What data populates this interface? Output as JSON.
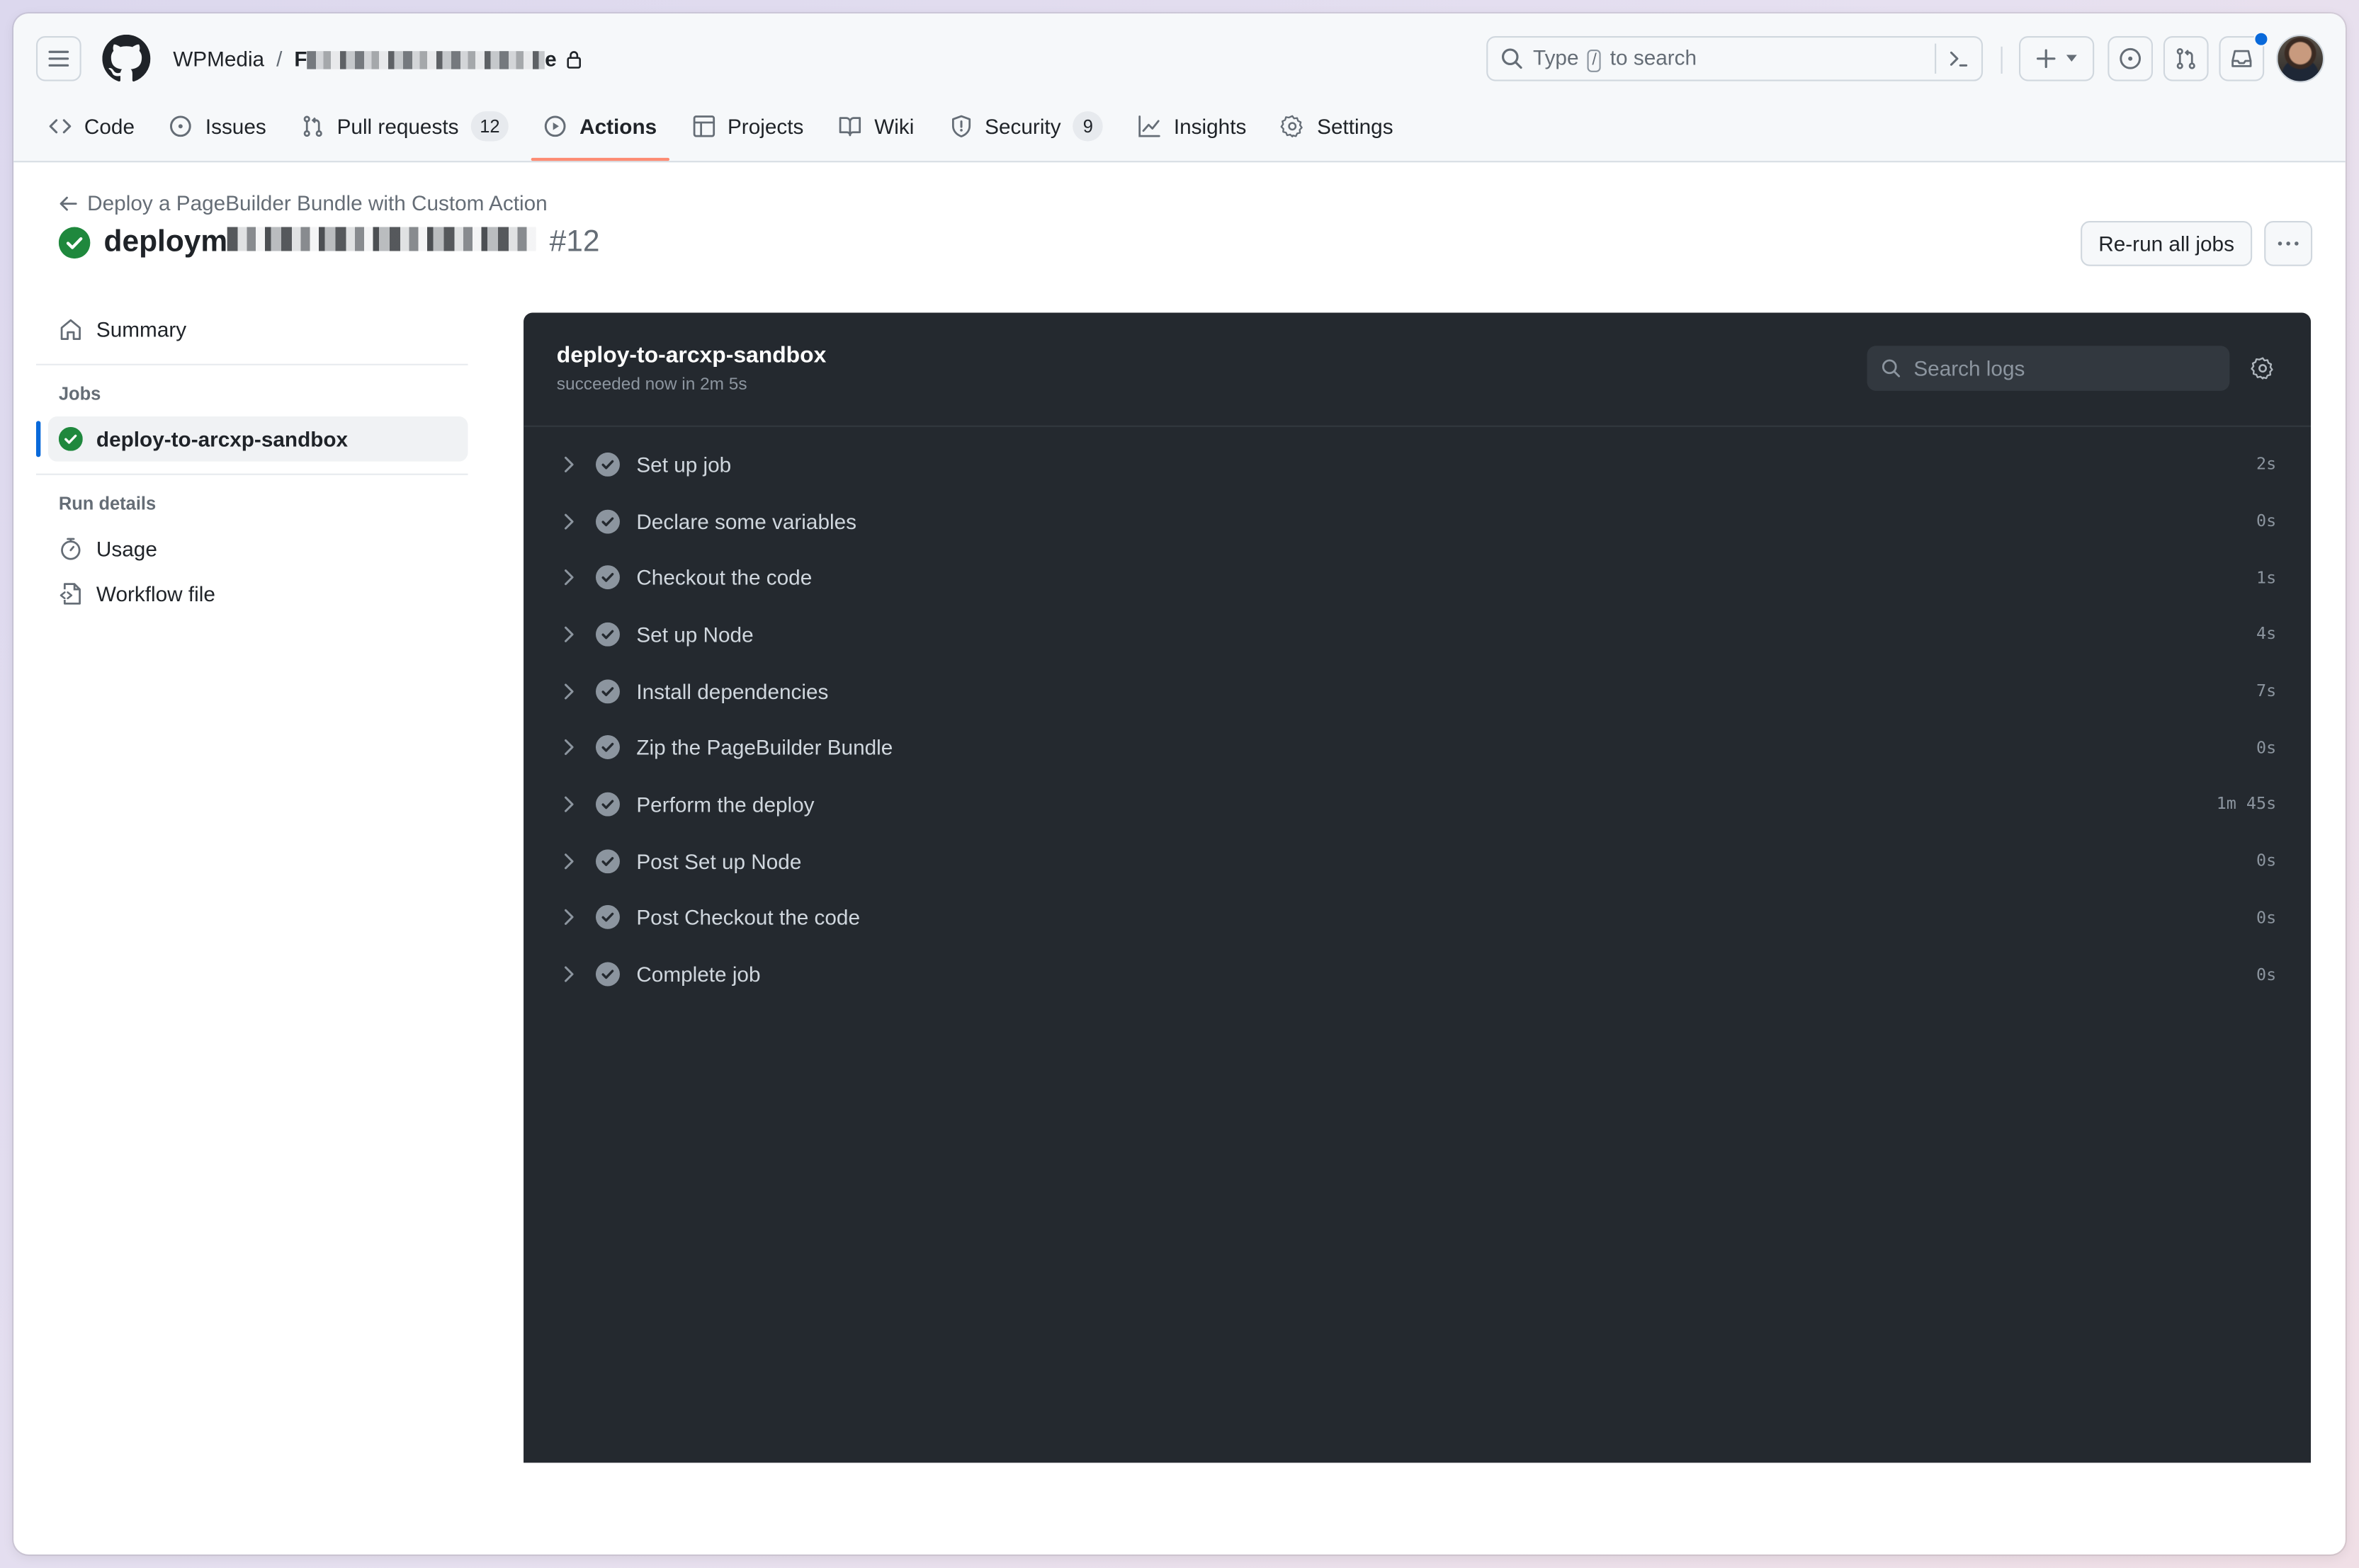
{
  "header": {
    "org": "WPMedia",
    "separator": "/",
    "repo_visible_prefix": "F",
    "repo_visible_suffix": "e",
    "search_placeholder_before": "Type",
    "search_key": "/",
    "search_placeholder_after": "to search",
    "notification_dot_color": "#0969da"
  },
  "tabs": [
    {
      "label": "Code",
      "icon": "code-icon"
    },
    {
      "label": "Issues",
      "icon": "issue-opened-icon"
    },
    {
      "label": "Pull requests",
      "icon": "git-pull-request-icon",
      "count": "12"
    },
    {
      "label": "Actions",
      "icon": "play-icon",
      "active": true
    },
    {
      "label": "Projects",
      "icon": "table-icon"
    },
    {
      "label": "Wiki",
      "icon": "book-icon"
    },
    {
      "label": "Security",
      "icon": "shield-icon",
      "count": "9"
    },
    {
      "label": "Insights",
      "icon": "graph-icon"
    },
    {
      "label": "Settings",
      "icon": "gear-icon"
    }
  ],
  "run": {
    "back_label": "Deploy a PageBuilder Bundle with Custom Action",
    "title_prefix": "deploym",
    "run_number": "#12",
    "status": "success",
    "rerun_label": "Re-run all jobs",
    "more_label": "···"
  },
  "sidebar": {
    "summary_label": "Summary",
    "jobs_heading": "Jobs",
    "jobs": [
      {
        "label": "deploy-to-arcxp-sandbox",
        "status": "success"
      }
    ],
    "run_details_heading": "Run details",
    "run_details": [
      {
        "label": "Usage",
        "icon": "stopwatch-icon"
      },
      {
        "label": "Workflow file",
        "icon": "file-code-icon"
      }
    ]
  },
  "job": {
    "name": "deploy-to-arcxp-sandbox",
    "status_text": "succeeded now in 2m 5s",
    "search_placeholder": "Search logs",
    "steps": [
      {
        "label": "Set up job",
        "duration": "2s"
      },
      {
        "label": "Declare some variables",
        "duration": "0s"
      },
      {
        "label": "Checkout the code",
        "duration": "1s"
      },
      {
        "label": "Set up Node",
        "duration": "4s"
      },
      {
        "label": "Install dependencies",
        "duration": "7s"
      },
      {
        "label": "Zip the PageBuilder Bundle",
        "duration": "0s"
      },
      {
        "label": "Perform the deploy",
        "duration": "1m 45s"
      },
      {
        "label": "Post Set up Node",
        "duration": "0s"
      },
      {
        "label": "Post Checkout the code",
        "duration": "0s"
      },
      {
        "label": "Complete job",
        "duration": "0s"
      }
    ]
  },
  "colors": {
    "success": "#1f883d",
    "active_tab_underline": "#fd8c73",
    "active_job_bar": "#0969da",
    "log_bg": "#24292f"
  }
}
